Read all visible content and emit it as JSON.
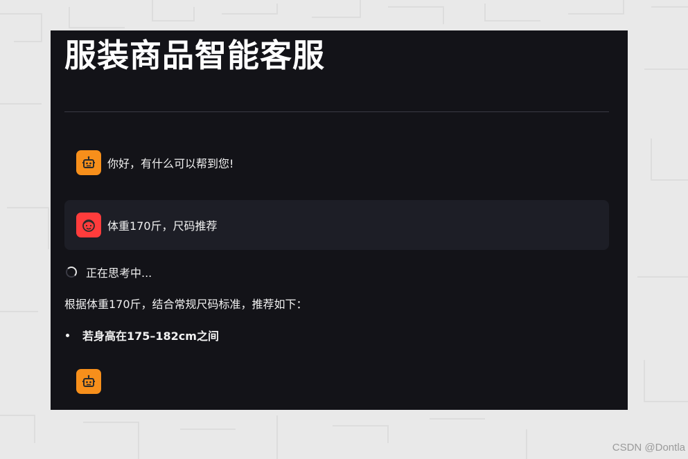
{
  "app": {
    "title": "服装商品智能客服"
  },
  "chat": {
    "messages": [
      {
        "role": "assistant",
        "avatar_icon": "robot-icon",
        "text": "你好，有什么可以帮到您!"
      },
      {
        "role": "user",
        "avatar_icon": "user-face-icon",
        "text": "体重170斤，尺码推荐"
      }
    ],
    "status_text": "正在思考中...",
    "answer": {
      "intro": "根据体重170斤，结合常规尺码标准，推荐如下：",
      "bullets": [
        "若身高在175–182cm之间"
      ]
    },
    "pending_avatar_icon": "robot-icon"
  },
  "colors": {
    "panel_bg": "#131318",
    "assistant_avatar": "#f78f1b",
    "user_avatar": "#ff3c3c",
    "user_message_bg": "#1d1e26"
  },
  "watermark": "CSDN @Dontla"
}
